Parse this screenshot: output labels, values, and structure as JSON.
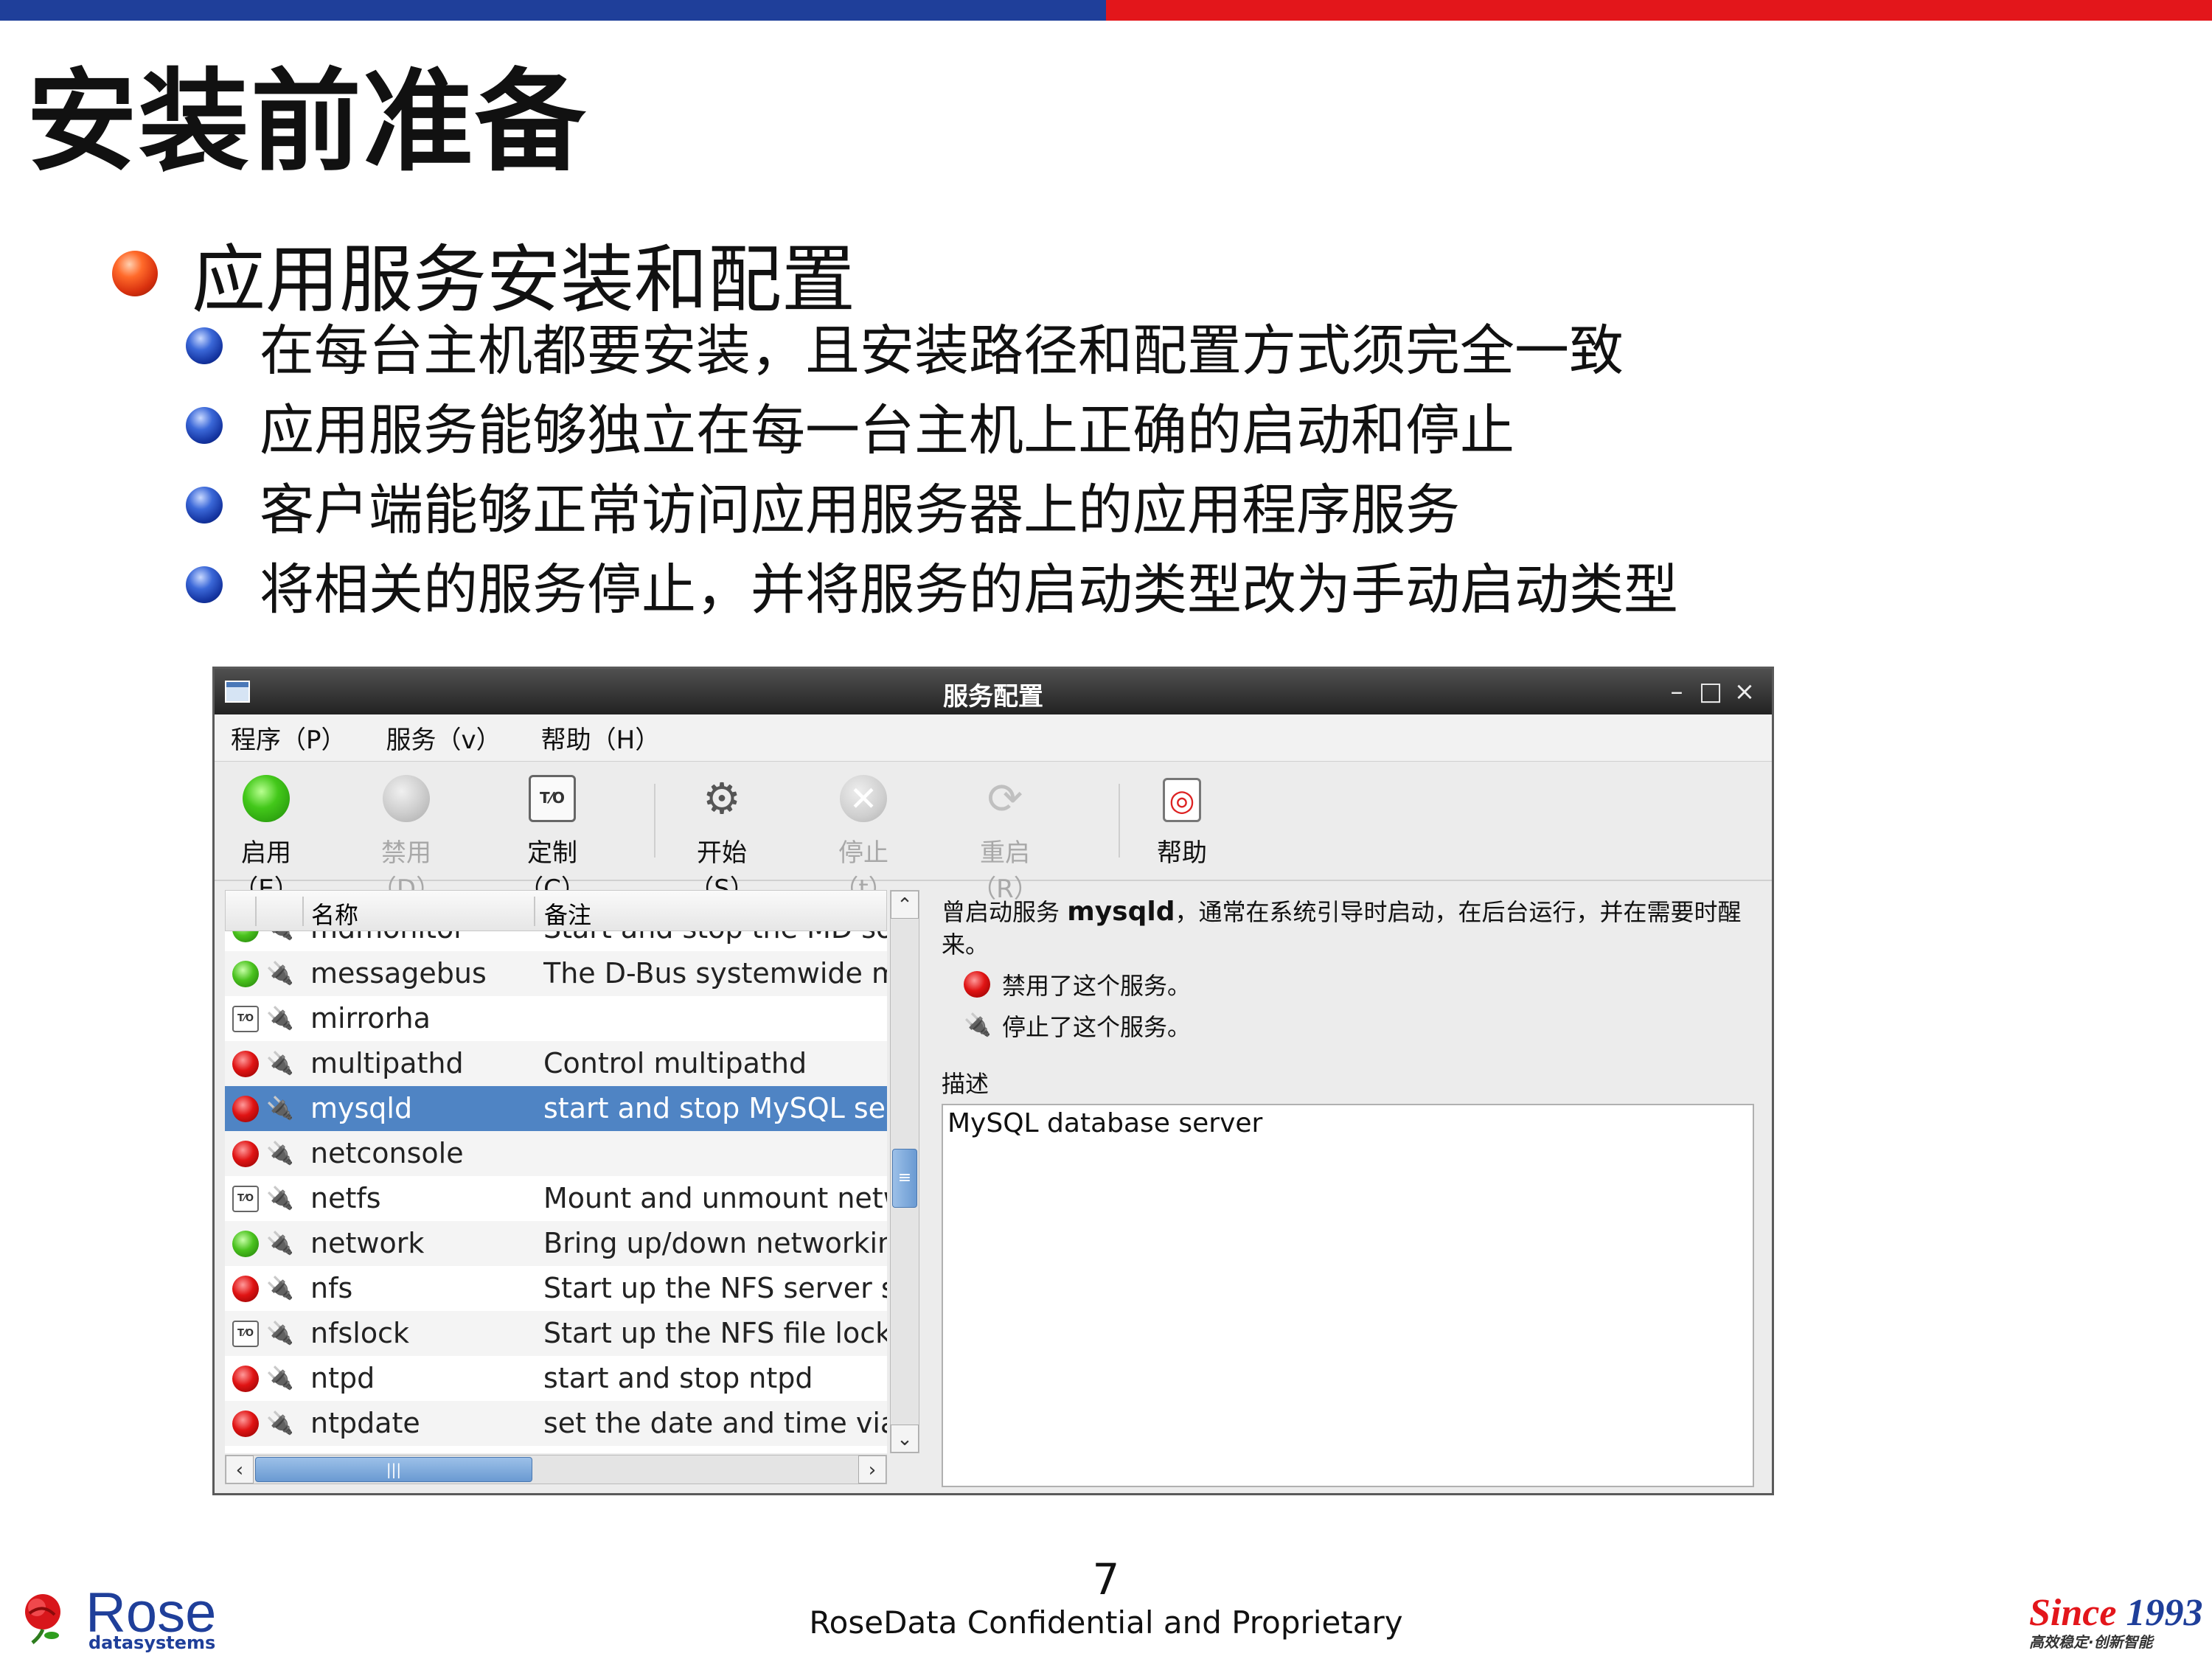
{
  "slide": {
    "title": "安装前准备",
    "bullet": "应用服务安装和配置",
    "sub_bullets": [
      "在每台主机都要安装，且安装路径和配置方式须完全一致",
      "应用服务能够独立在每一台主机上正确的启动和停止",
      "客户端能够正常访问应用服务器上的应用程序服务",
      "将相关的服务停止，并将服务的启动类型改为手动启动类型"
    ],
    "page_number": "7",
    "footer": "RoseData Confidential and Proprietary",
    "logo_left": {
      "name": "Rose",
      "sub": "datasystems"
    },
    "logo_right": {
      "main_a": "Since ",
      "main_b": "1993",
      "sub": "高效稳定·创新智能"
    }
  },
  "window": {
    "title": "服务配置",
    "controls": {
      "minimize": "–",
      "maximize": "□",
      "close": "×"
    },
    "menu": [
      "程序（P）",
      "服务（v）",
      "帮助（H）"
    ],
    "toolbar": {
      "enable": "启用（E）",
      "disable": "禁用（D）",
      "customize": "定制（C）",
      "start": "开始（S）",
      "stop": "停止（t）",
      "restart": "重启（R）",
      "help": "帮助"
    },
    "columns": {
      "name": "名称",
      "remark": "备注"
    },
    "partial_row": {
      "name": "mdmonitor",
      "desc": "Start and stop the MD soft"
    },
    "rows": [
      {
        "name": "messagebus",
        "desc": "The D-Bus systemwide me"
      },
      {
        "name": "mirrorha",
        "desc": ""
      },
      {
        "name": "multipathd",
        "desc": "Control multipathd"
      },
      {
        "name": "mysqld",
        "desc": "start and stop MySQL serve"
      },
      {
        "name": "netconsole",
        "desc": ""
      },
      {
        "name": "netfs",
        "desc": "Mount and unmount netwo"
      },
      {
        "name": "network",
        "desc": "Bring up/down networking"
      },
      {
        "name": "nfs",
        "desc": "Start up the NFS server sev"
      },
      {
        "name": "nfslock",
        "desc": "Start up the NFS file lockin"
      },
      {
        "name": "ntpd",
        "desc": "start and stop ntpd"
      },
      {
        "name": "ntpdate",
        "desc": "set the date and time via N"
      }
    ],
    "selected_service": "mysqld",
    "detail": {
      "intro_a": "曾启动服务 ",
      "service": "mysqld",
      "intro_b": "，通常在系统引导时启动，在后台运行，并在需要时醒来。",
      "status1": "禁用了这个服务。",
      "status2": "停止了这个服务。",
      "desc_label": "描述",
      "desc": "MySQL database server"
    },
    "icons": {
      "plug": "🔌",
      "custom_box": "T⁄O"
    }
  }
}
